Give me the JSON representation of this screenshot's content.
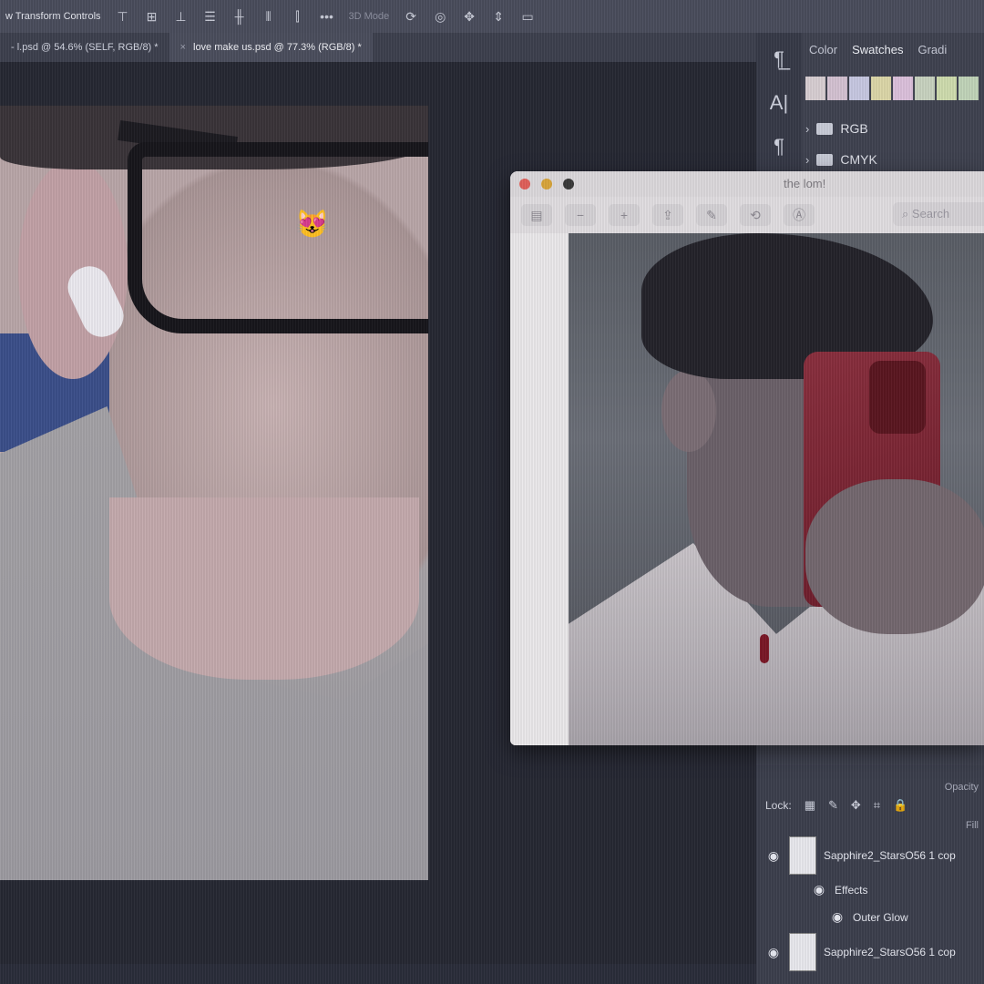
{
  "options_bar": {
    "label": "w Transform Controls",
    "mode_label": "3D Mode",
    "icons": [
      "align-top-icon",
      "align-vcenter-icon",
      "align-bottom-icon",
      "align-left-icon",
      "align-hcenter-icon",
      "align-right-icon",
      "distribute-icon",
      "more-icon",
      "orbit-3d-icon",
      "roll-3d-icon",
      "pan-3d-icon",
      "slide-3d-icon",
      "video-camera-icon"
    ]
  },
  "doc_tabs": [
    {
      "label": "- l.psd @ 54.6% (SELF, RGB/8) *",
      "active": false
    },
    {
      "label": "love make us.psd @ 77.3% (RGB/8) *",
      "active": true
    }
  ],
  "right_panel": {
    "tabs": [
      "Color",
      "Swatches",
      "Gradi"
    ],
    "active_tab": "Swatches",
    "swatch_colors": [
      "#d8cfd3",
      "#d4c2d2",
      "#c7c8e2",
      "#dcd7a8",
      "#dcc1dc",
      "#c8d3c0",
      "#cfdcae",
      "#c1d4b9",
      "#d6ccb4"
    ],
    "swatch_groups": [
      "RGB",
      "CMYK"
    ],
    "side_icons": [
      "character-style-icon",
      "text-tool-icon",
      "paragraph-icon"
    ]
  },
  "layers_panel": {
    "lock_label": "Lock:",
    "opacity_label": "Opacity",
    "fill_label": "Fill",
    "layers": [
      {
        "name": "Sapphire2_StarsO56 1 cop",
        "kind": "layer"
      },
      {
        "name": "Effects",
        "kind": "effects"
      },
      {
        "name": "Outer Glow",
        "kind": "effect"
      },
      {
        "name": "Sapphire2_StarsO56 1 cop",
        "kind": "layer"
      }
    ]
  },
  "preview_window": {
    "title": "the lom!",
    "search_placeholder": "Search",
    "traffic_lights": [
      "#e0605a",
      "#d9a53a",
      "#3a3a3a"
    ]
  },
  "photo1_overlay_emoji": "😻"
}
